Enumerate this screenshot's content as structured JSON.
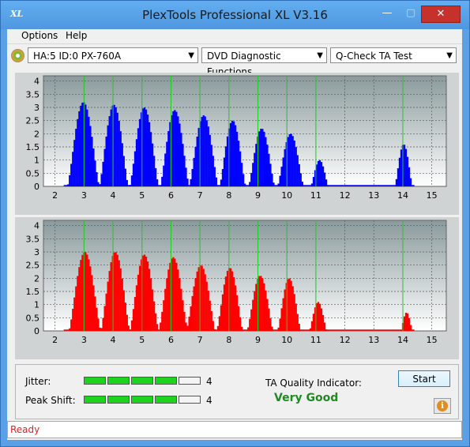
{
  "window": {
    "title": "PlexTools Professional XL V3.16",
    "icon_label": "XL",
    "minimize": "—",
    "maximize": "▢",
    "close": "✕"
  },
  "menu": {
    "items": [
      "Options",
      "Help"
    ]
  },
  "toolbar": {
    "drive": "HA:5 ID:0  PX-760A",
    "function": "DVD Diagnostic Functions",
    "test": "Q-Check TA Test"
  },
  "chart_data": [
    {
      "type": "bar",
      "name": "upper",
      "color": "#0000ff",
      "x_ticks": [
        2,
        3,
        4,
        5,
        6,
        7,
        8,
        9,
        10,
        11,
        12,
        13,
        14,
        15
      ],
      "y_ticks": [
        "4",
        "3.5",
        "3",
        "2.5",
        "2",
        "1.5",
        "1",
        "0.5",
        "0"
      ],
      "ylim": [
        0,
        4.2
      ],
      "xlim": [
        1.6,
        15.5
      ],
      "green_lines": [
        3,
        4,
        5,
        6,
        7,
        8,
        9,
        10,
        11,
        14
      ],
      "peaks": [
        {
          "center": 2.95,
          "height": 3.2,
          "width": 0.55
        },
        {
          "center": 4.0,
          "height": 3.1,
          "width": 0.5
        },
        {
          "center": 5.05,
          "height": 3.0,
          "width": 0.5
        },
        {
          "center": 6.1,
          "height": 2.9,
          "width": 0.5
        },
        {
          "center": 7.1,
          "height": 2.7,
          "width": 0.5
        },
        {
          "center": 8.1,
          "height": 2.5,
          "width": 0.45
        },
        {
          "center": 9.1,
          "height": 2.2,
          "width": 0.45
        },
        {
          "center": 10.1,
          "height": 2.0,
          "width": 0.45
        },
        {
          "center": 11.1,
          "height": 1.0,
          "width": 0.3
        },
        {
          "center": 14.0,
          "height": 1.6,
          "width": 0.3
        }
      ]
    },
    {
      "type": "bar",
      "name": "lower",
      "color": "#ff0000",
      "x_ticks": [
        2,
        3,
        4,
        5,
        6,
        7,
        8,
        9,
        10,
        11,
        12,
        13,
        14,
        15
      ],
      "y_ticks": [
        "4",
        "3.5",
        "3",
        "2.5",
        "2",
        "1.5",
        "1",
        "0.5",
        "0"
      ],
      "ylim": [
        0,
        4.2
      ],
      "xlim": [
        1.6,
        15.5
      ],
      "green_lines": [
        3,
        4,
        5,
        6,
        7,
        8,
        9,
        10,
        11,
        14
      ],
      "peaks": [
        {
          "center": 3.0,
          "height": 3.0,
          "width": 0.55
        },
        {
          "center": 4.05,
          "height": 3.0,
          "width": 0.5
        },
        {
          "center": 5.05,
          "height": 2.9,
          "width": 0.5
        },
        {
          "center": 6.05,
          "height": 2.8,
          "width": 0.5
        },
        {
          "center": 7.0,
          "height": 2.5,
          "width": 0.5
        },
        {
          "center": 8.0,
          "height": 2.4,
          "width": 0.45
        },
        {
          "center": 9.05,
          "height": 2.1,
          "width": 0.45
        },
        {
          "center": 10.05,
          "height": 2.0,
          "width": 0.4
        },
        {
          "center": 11.05,
          "height": 1.1,
          "width": 0.3
        },
        {
          "center": 14.1,
          "height": 0.7,
          "width": 0.2
        }
      ]
    }
  ],
  "results": {
    "jitter_label": "Jitter:",
    "jitter_value": "4",
    "jitter_level": 4,
    "peak_label": "Peak Shift:",
    "peak_value": "4",
    "peak_level": 4,
    "max_level": 5,
    "ta_label": "TA Quality Indicator:",
    "ta_value": "Very Good",
    "start_label": "Start",
    "info_label": "i"
  },
  "status": {
    "text": "Ready"
  }
}
